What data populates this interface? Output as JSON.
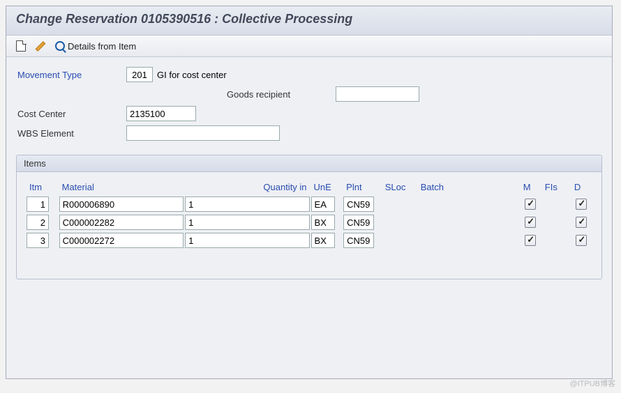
{
  "title": "Change Reservation 0105390516 : Collective Processing",
  "toolbar": {
    "details_label": "Details from Item"
  },
  "form": {
    "movement_type_label": "Movement Type",
    "movement_type_value": "201",
    "movement_type_text": "GI for cost center",
    "goods_recipient_label": "Goods recipient",
    "goods_recipient_value": "",
    "cost_center_label": "Cost Center",
    "cost_center_value": "2135100",
    "wbs_label": "WBS Element",
    "wbs_value": ""
  },
  "items": {
    "panel_label": "Items",
    "headers": {
      "itm": "Itm",
      "material": "Material",
      "quantity": "Quantity in",
      "une": "UnE",
      "plnt": "Plnt",
      "sloc": "SLoc",
      "batch": "Batch",
      "m": "M",
      "fis": "FIs",
      "d": "D"
    },
    "rows": [
      {
        "itm": "1",
        "material": "R000006890",
        "qty": "1",
        "une": "EA",
        "plnt": "CN59",
        "sloc": "",
        "batch": "",
        "m": true,
        "fis": "",
        "d": true
      },
      {
        "itm": "2",
        "material": "C000002282",
        "qty": "1",
        "une": "BX",
        "plnt": "CN59",
        "sloc": "",
        "batch": "",
        "m": true,
        "fis": "",
        "d": true
      },
      {
        "itm": "3",
        "material": "C000002272",
        "qty": "1",
        "une": "BX",
        "plnt": "CN59",
        "sloc": "",
        "batch": "",
        "m": true,
        "fis": "",
        "d": true
      }
    ]
  },
  "watermark": "@ITPUB博客"
}
